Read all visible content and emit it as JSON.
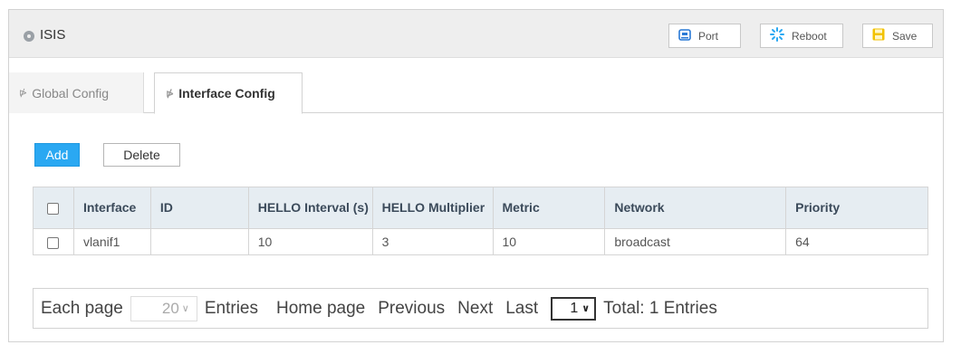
{
  "header": {
    "title": "ISIS",
    "icon": "circle-icon",
    "buttons": {
      "port": "Port",
      "reboot": "Reboot",
      "save": "Save"
    }
  },
  "tabs": [
    {
      "label": "Global Config",
      "active": false
    },
    {
      "label": "Interface Config",
      "active": true
    }
  ],
  "actions": {
    "add": "Add",
    "delete": "Delete"
  },
  "table": {
    "headers": {
      "interface": "Interface",
      "id": "ID",
      "hello_interval": "HELLO Interval (s)",
      "hello_multiplier": "HELLO Multiplier",
      "metric": "Metric",
      "network": "Network",
      "priority": "Priority"
    },
    "rows": [
      {
        "interface": "vlanif1",
        "id": "",
        "hello_interval": "10",
        "hello_multiplier": "3",
        "metric": "10",
        "network": "broadcast",
        "priority": "64"
      }
    ]
  },
  "pagination": {
    "each_page_label": "Each page",
    "page_size": "20",
    "entries_label": "Entries",
    "home": "Home page",
    "previous": "Previous",
    "next": "Next",
    "last": "Last",
    "current_page": "1",
    "total": "Total: 1 Entries"
  },
  "colors": {
    "accent": "#2aa8f2",
    "header_bg": "#eeeeee",
    "table_header_bg": "#e6edf2",
    "port_icon": "#2a7ad6",
    "reboot_icon": "#2aa8f2",
    "save_icon": "#f2c200"
  }
}
